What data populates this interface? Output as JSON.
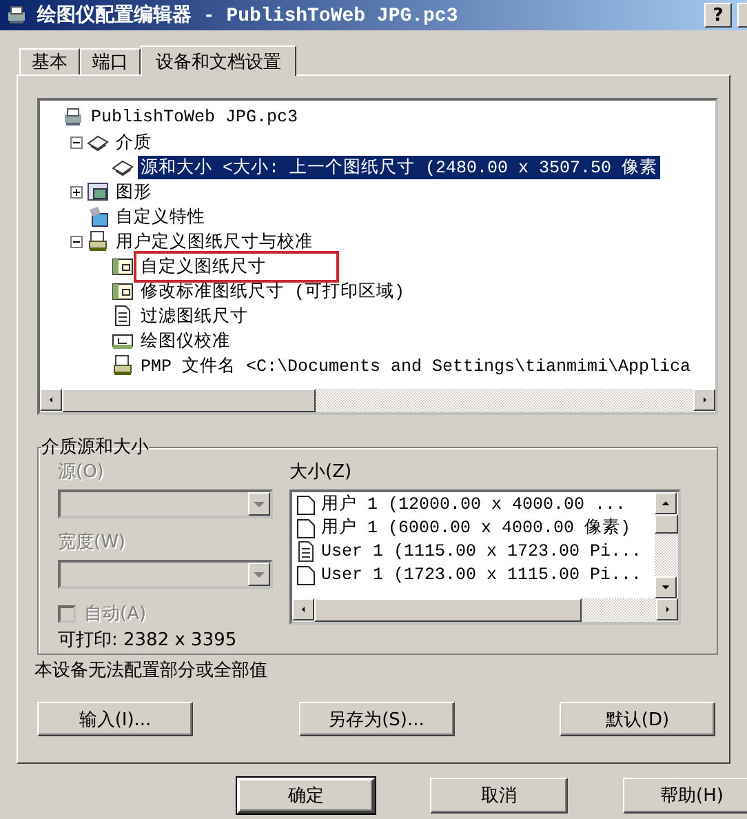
{
  "window": {
    "title": "绘图仪配置编辑器 - PublishToWeb JPG.pc3",
    "help_button": "?"
  },
  "tabs": [
    {
      "label": "基本",
      "selected": false
    },
    {
      "label": "端口",
      "selected": false
    },
    {
      "label": "设备和文档设置",
      "selected": true
    }
  ],
  "tree": {
    "items": [
      {
        "label": "PublishToWeb JPG.pc3",
        "kind": "printer",
        "selected": false,
        "highlighted": false,
        "children": [
          {
            "label": "介质",
            "kind": "media",
            "selected": false,
            "highlighted": false,
            "expanded": true,
            "children": [
              {
                "label": "源和大小 <大小: 上一个图纸尺寸 (2480.00 x 3507.50 像素",
                "kind": "media",
                "selected": true,
                "highlighted": false
              }
            ]
          },
          {
            "label": "图形",
            "kind": "graphic",
            "selected": false,
            "highlighted": false,
            "expanded": false
          },
          {
            "label": "自定义特性",
            "kind": "properties",
            "selected": false,
            "highlighted": false
          },
          {
            "label": "用户定义图纸尺寸与校准",
            "kind": "plotter",
            "selected": false,
            "highlighted": false,
            "expanded": true,
            "children": [
              {
                "label": "自定义图纸尺寸",
                "kind": "paper",
                "selected": false,
                "highlighted": true
              },
              {
                "label": "修改标准图纸尺寸 (可打印区域)",
                "kind": "paper",
                "selected": false,
                "highlighted": false
              },
              {
                "label": "过滤图纸尺寸",
                "kind": "document",
                "selected": false,
                "highlighted": false
              },
              {
                "label": "绘图仪校准",
                "kind": "calibrate",
                "selected": false,
                "highlighted": false
              },
              {
                "label": "PMP 文件名 <C:\\Documents and Settings\\tianmimi\\Applica",
                "kind": "plotter",
                "selected": false,
                "highlighted": false
              }
            ]
          }
        ]
      }
    ]
  },
  "media_group": {
    "title": "介质源和大小",
    "source": {
      "label": "源(O)",
      "disabled": true
    },
    "width": {
      "label": "宽度(W)",
      "disabled": true
    },
    "auto": {
      "label": "自动(A)",
      "checked": false,
      "disabled": true
    },
    "printable": "可打印: 2382 x 3395",
    "size": {
      "label": "大小(Z)",
      "items": [
        {
          "label": "用户 1 (12000.00 x 4000.00 ...",
          "kind": "blank",
          "selected": false
        },
        {
          "label": "用户 1 (6000.00 x 4000.00 像素)",
          "kind": "blank",
          "selected": false
        },
        {
          "label": "User 1 (1115.00 x 1723.00 Pi...",
          "kind": "document",
          "selected": false
        },
        {
          "label": "User 1 (1723.00 x 1115.00 Pi...",
          "kind": "blank",
          "selected": false
        }
      ]
    }
  },
  "status": "本设备无法配置部分或全部值",
  "device_buttons": [
    "输入(I)...",
    "另存为(S)...",
    "默认(D)"
  ],
  "dialog_buttons": [
    {
      "label": "确定",
      "default": true
    },
    {
      "label": "取消",
      "default": false
    },
    {
      "label": "帮助(H)",
      "default": false
    }
  ]
}
